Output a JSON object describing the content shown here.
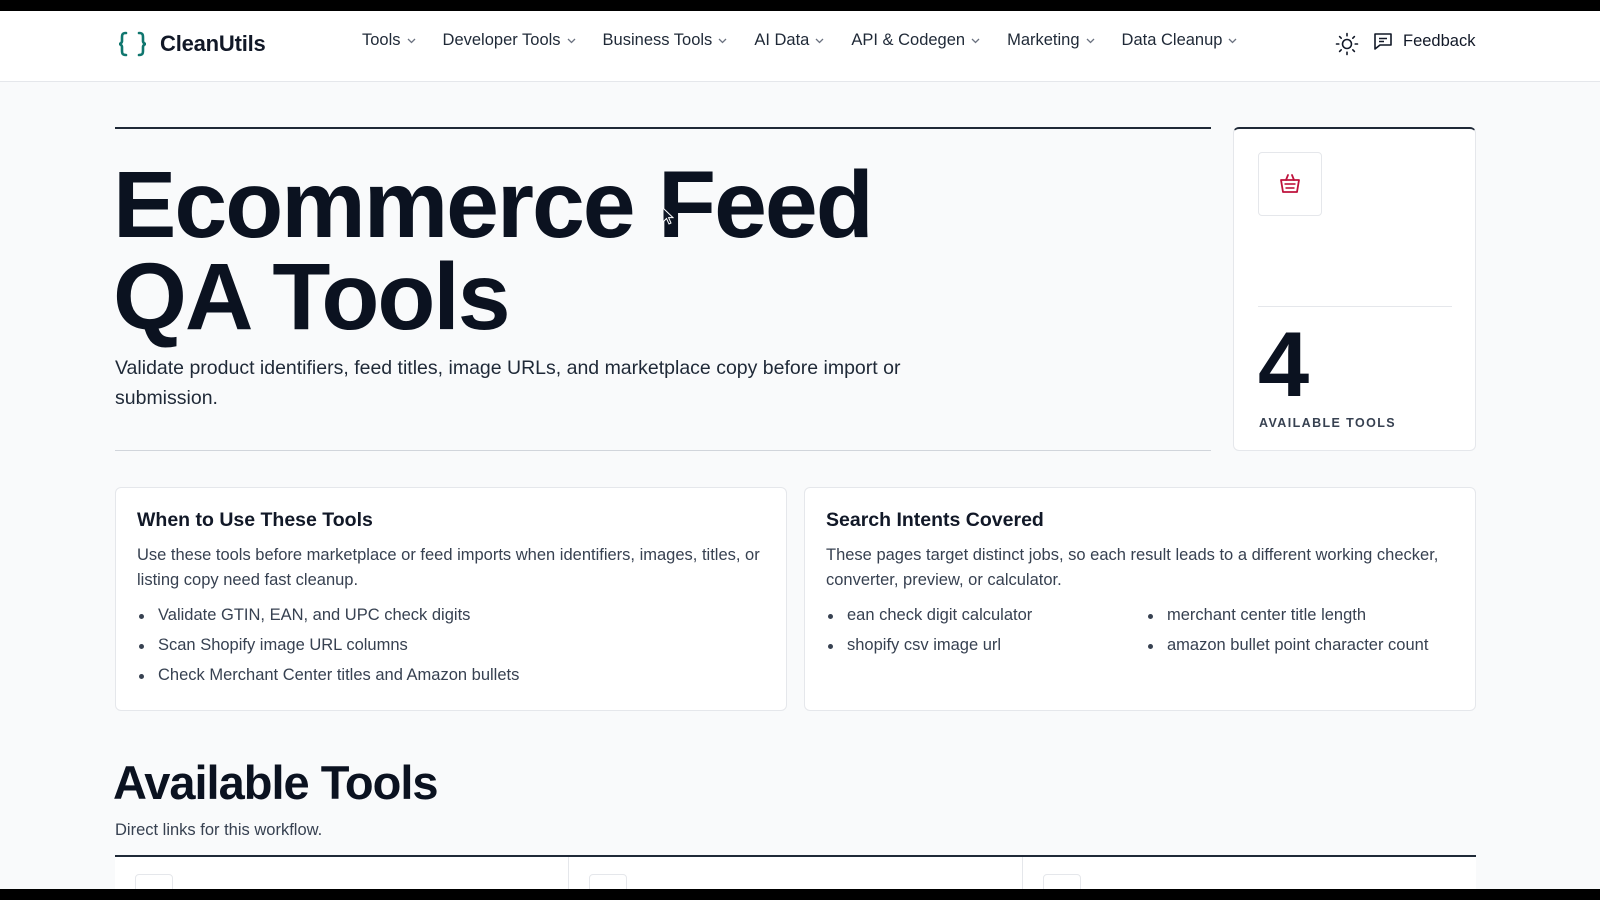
{
  "app": {
    "logo_text": "CleanUtils",
    "logo_glyph": "{ }",
    "accent_color": "#0f766e",
    "brand_icon": "braces-icon"
  },
  "nav": {
    "items": [
      {
        "label": "Tools"
      },
      {
        "label": "Developer Tools"
      },
      {
        "label": "Business Tools"
      },
      {
        "label": "AI Data"
      },
      {
        "label": "API & Codegen"
      },
      {
        "label": "Marketing"
      },
      {
        "label": "Data Cleanup"
      }
    ],
    "theme_icon": "sun-icon",
    "feedback_label": "Feedback",
    "feedback_icon": "message-icon"
  },
  "hero": {
    "title_line1": "Ecommerce Feed",
    "title_line2": "QA Tools",
    "subtitle": "Validate product identifiers, feed titles, image URLs, and marketplace copy before import or submission."
  },
  "stat": {
    "icon": "shopping-basket-icon",
    "icon_color": "#be123c",
    "value": "4",
    "label": "AVAILABLE TOOLS"
  },
  "when_card": {
    "title": "When to Use These Tools",
    "description": "Use these tools before marketplace or feed imports when identifiers, images, titles, or listing copy need fast cleanup.",
    "bullets": [
      "Validate GTIN, EAN, and UPC check digits",
      "Scan Shopify image URL columns",
      "Check Merchant Center titles and Amazon bullets"
    ]
  },
  "intents_card": {
    "title": "Search Intents Covered",
    "description": "These pages target distinct jobs, so each result leads to a different working checker, converter, preview, or calculator.",
    "bullets": [
      "ean check digit calculator",
      "shopify csv image url",
      "merchant center title length",
      "amazon bullet point character count"
    ]
  },
  "available": {
    "title": "Available Tools",
    "subtitle": "Direct links for this workflow."
  }
}
